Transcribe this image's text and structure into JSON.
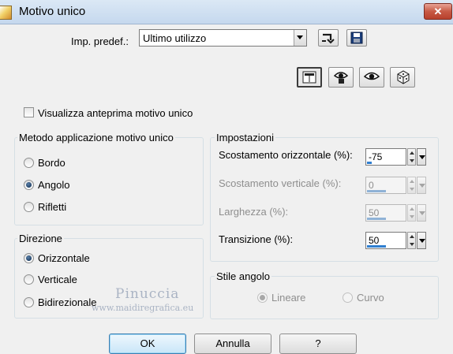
{
  "window": {
    "title": "Motivo unico",
    "close_glyph": "✕"
  },
  "preset": {
    "label": "Imp. predef.:",
    "value": "Ultimo utilizzo"
  },
  "toolbar_icons": [
    "reset-icon",
    "save-icon",
    "preview-toggle-icon",
    "eye-lock-icon",
    "eye-icon",
    "random-dice-icon"
  ],
  "preview_checkbox": {
    "label": "Visualizza anteprima motivo unico",
    "checked": false
  },
  "method_group": {
    "title": "Metodo applicazione motivo unico",
    "options": [
      {
        "label": "Bordo",
        "checked": false
      },
      {
        "label": "Angolo",
        "checked": true
      },
      {
        "label": "Rifletti",
        "checked": false
      }
    ]
  },
  "direction_group": {
    "title": "Direzione",
    "options": [
      {
        "label": "Orizzontale",
        "checked": true
      },
      {
        "label": "Verticale",
        "checked": false
      },
      {
        "label": "Bidirezionale",
        "checked": false
      }
    ]
  },
  "settings_group": {
    "title": "Impostazioni",
    "fields": [
      {
        "label": "Scostamento orizzontale (%):",
        "value": "-75",
        "enabled": true,
        "level": 0.125
      },
      {
        "label": "Scostamento verticale (%):",
        "value": "0",
        "enabled": false,
        "level": 0.5
      },
      {
        "label": "Larghezza (%):",
        "value": "50",
        "enabled": false,
        "level": 0.5
      },
      {
        "label": "Transizione (%):",
        "value": "50",
        "enabled": true,
        "level": 0.5
      }
    ]
  },
  "corner_style_group": {
    "title": "Stile angolo",
    "options": [
      {
        "label": "Lineare",
        "checked": true,
        "enabled": false
      },
      {
        "label": "Curvo",
        "checked": false,
        "enabled": false
      }
    ]
  },
  "watermark": {
    "line1": "Pinuccia",
    "line2": "www.maidiregrafica.eu"
  },
  "buttons": {
    "ok": "OK",
    "cancel": "Annulla",
    "help": "?"
  },
  "colors": {
    "accent": "#2f7ecf",
    "close": "#c75a45",
    "titlebar": "#c5d8ee"
  }
}
